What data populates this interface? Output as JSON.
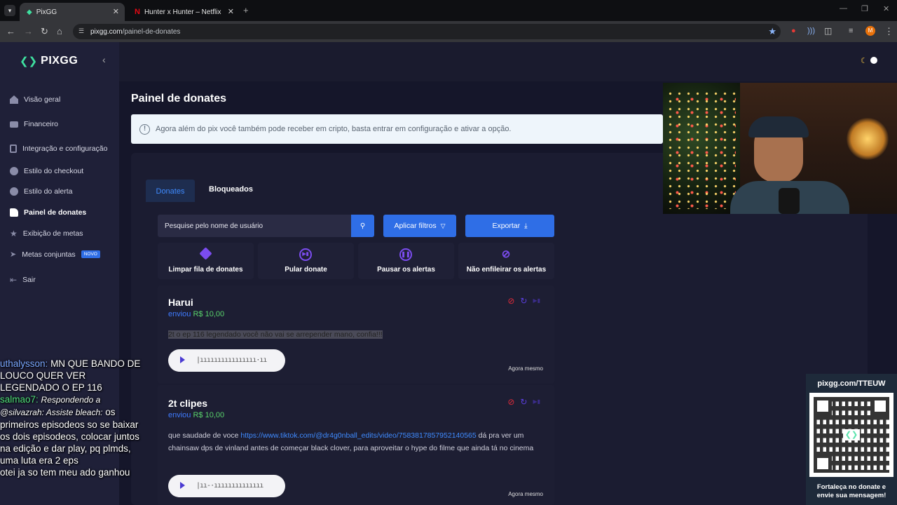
{
  "browser": {
    "tabs": [
      {
        "title": "PixGG",
        "active": true
      },
      {
        "title": "Hunter x Hunter – Netflix",
        "active": false
      }
    ],
    "url_domain": "pixgg.com",
    "url_path": "/painel-de-donates"
  },
  "sidebar": {
    "brand": "PIXGG",
    "items": [
      {
        "label": "Visão geral",
        "icon": "home-icon"
      },
      {
        "label": "Financeiro",
        "icon": "wallet-icon"
      },
      {
        "label": "Integração e configuração",
        "icon": "settings-icon"
      },
      {
        "label": "Estilo do checkout",
        "icon": "palette-icon"
      },
      {
        "label": "Estilo do alerta",
        "icon": "palette-icon"
      },
      {
        "label": "Painel de donates",
        "icon": "thumbs-up-icon",
        "active": true
      },
      {
        "label": "Exibição de metas",
        "icon": "star-icon"
      },
      {
        "label": "Metas conjuntas",
        "icon": "rocket-icon",
        "badge": "NOVO"
      },
      {
        "label": "Sair",
        "icon": "logout-icon"
      }
    ]
  },
  "page": {
    "title": "Painel de donates",
    "info_banner": "Agora além do pix você também pode receber em cripto, basta entrar em configuração e ativar a opção.",
    "tabs": [
      "Donates",
      "Bloqueados"
    ],
    "search_placeholder": "Pesquise pelo nome de usuário",
    "filter_label": "Aplicar filtros",
    "export_label": "Exportar",
    "actions": [
      {
        "label": "Limpar fila de donates",
        "icon": "eraser-icon"
      },
      {
        "label": "Pular donate",
        "icon": "skip-icon"
      },
      {
        "label": "Pausar os alertas",
        "icon": "pause-icon"
      },
      {
        "label": "Não enfileirar os alertas",
        "icon": "bell-off-icon"
      }
    ]
  },
  "donates": [
    {
      "name": "Harui",
      "sent_label": "enviou",
      "amount": "R$ 10,00",
      "message": "2t o ep 116 legendado você não vai se arrepender mano, confia!!!",
      "time": "Agora mesmo"
    },
    {
      "name": "2t clipes",
      "sent_label": "enviou",
      "amount": "R$ 10,00",
      "message_before": "que saudade de voce ",
      "message_link": "https://www.tiktok.com/@dr4g0nball_edits/video/7583817857952140565",
      "message_after": " dá pra ver um chainsaw dps de vinland antes de começar black clover, para aproveitar o hype do filme que ainda tá no cinema",
      "time": "Agora mesmo"
    }
  ],
  "chat": [
    {
      "user": "uthalysson:",
      "text": "MN QUE BANDO DE LOUCO QUER VER LEGENDADO O EP 116"
    },
    {
      "user": "salmao7:",
      "reply": "Respondendo a @silvazrah: Assiste bleach:",
      "text": "os primeiros episodeos so se baixar os dois episodeos, colocar juntos na edição e dar play, pq plmds, uma luta era 2 eps"
    },
    {
      "user": "",
      "text": "otei ja so tem meu ado ganhou"
    }
  ],
  "qr": {
    "url": "pixgg.com/TTEUW",
    "caption": "Fortaleça no donate e envie sua mensagem!"
  },
  "colors": {
    "accent": "#3f7bff",
    "amount": "#59d26b",
    "button": "#2f6ee6",
    "danger": "#e02b3a"
  }
}
